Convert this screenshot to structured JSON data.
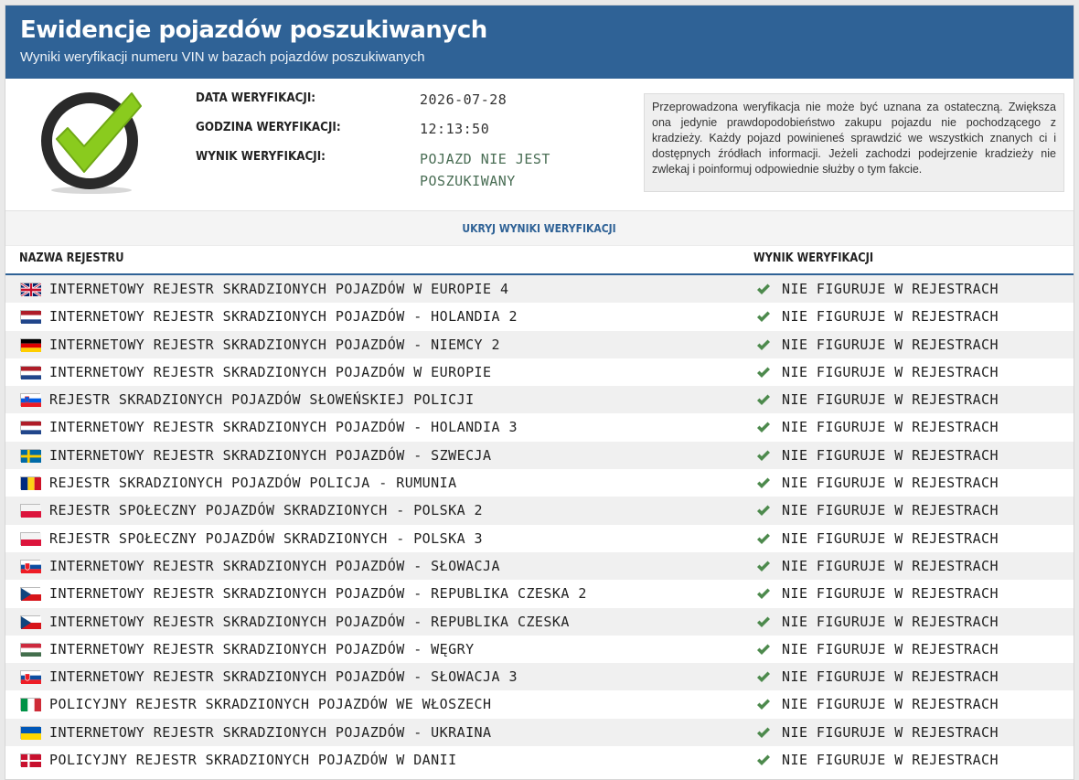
{
  "header": {
    "title": "Ewidencje pojazdów poszukiwanych",
    "subtitle": "Wyniki weryfikacji numeru VIN w bazach pojazdów poszukiwanych"
  },
  "summary": {
    "date_label": "DATA WERYFIKACJI:",
    "date_value": "2026-07-28",
    "time_label": "GODZINA WERYFIKACJI:",
    "time_value": "12:13:50",
    "result_label": "WYNIK WERYFIKACJI:",
    "result_value": "POJAZD NIE JEST POSZUKIWANY",
    "note": "Przeprowadzona weryfikacja nie może być uznana za ostateczną. Zwiększa ona jedynie prawdopodobieństwo zakupu pojazdu nie pochodzącego z kradzieży. Każdy pojazd powinieneś sprawdzić we wszystkich znanych ci i dostępnych źródłach informacji. Jeżeli zachodzi podejrzenie kradzieży nie zwlekaj i poinformuj odpowiednie służby o tym fakcie."
  },
  "toggle_label": "UKRYJ WYNIKI WERYFIKACJI",
  "table": {
    "col_name": "NAZWA REJESTRU",
    "col_result": "WYNIK WERYFIKACJI",
    "rows": [
      {
        "flag": "uk",
        "name": "INTERNETOWY REJESTR SKRADZIONYCH POJAZDÓW W EUROPIE 4",
        "result": "NIE FIGURUJE W REJESTRACH"
      },
      {
        "flag": "nl",
        "name": "INTERNETOWY REJESTR SKRADZIONYCH POJAZDÓW - HOLANDIA 2",
        "result": "NIE FIGURUJE W REJESTRACH"
      },
      {
        "flag": "de",
        "name": "INTERNETOWY REJESTR SKRADZIONYCH POJAZDÓW - NIEMCY 2",
        "result": "NIE FIGURUJE W REJESTRACH"
      },
      {
        "flag": "nl",
        "name": "INTERNETOWY REJESTR SKRADZIONYCH POJAZDÓW W EUROPIE",
        "result": "NIE FIGURUJE W REJESTRACH"
      },
      {
        "flag": "si",
        "name": "REJESTR SKRADZIONYCH POJAZDÓW SŁOWEŃSKIEJ POLICJI",
        "result": "NIE FIGURUJE W REJESTRACH"
      },
      {
        "flag": "nl",
        "name": "INTERNETOWY REJESTR SKRADZIONYCH POJAZDÓW - HOLANDIA 3",
        "result": "NIE FIGURUJE W REJESTRACH"
      },
      {
        "flag": "se",
        "name": "INTERNETOWY REJESTR SKRADZIONYCH POJAZDÓW - SZWECJA",
        "result": "NIE FIGURUJE W REJESTRACH"
      },
      {
        "flag": "ro",
        "name": "REJESTR SKRADZIONYCH POJAZDÓW POLICJA - RUMUNIA",
        "result": "NIE FIGURUJE W REJESTRACH"
      },
      {
        "flag": "pl",
        "name": "REJESTR SPOŁECZNY POJAZDÓW SKRADZIONYCH - POLSKA 2",
        "result": "NIE FIGURUJE W REJESTRACH"
      },
      {
        "flag": "pl",
        "name": "REJESTR SPOŁECZNY POJAZDÓW SKRADZIONYCH - POLSKA 3",
        "result": "NIE FIGURUJE W REJESTRACH"
      },
      {
        "flag": "sk",
        "name": "INTERNETOWY REJESTR SKRADZIONYCH POJAZDÓW - SŁOWACJA",
        "result": "NIE FIGURUJE W REJESTRACH"
      },
      {
        "flag": "cz",
        "name": "INTERNETOWY REJESTR SKRADZIONYCH POJAZDÓW - REPUBLIKA CZESKA 2",
        "result": "NIE FIGURUJE W REJESTRACH"
      },
      {
        "flag": "cz",
        "name": "INTERNETOWY REJESTR SKRADZIONYCH POJAZDÓW - REPUBLIKA CZESKA",
        "result": "NIE FIGURUJE W REJESTRACH"
      },
      {
        "flag": "hu",
        "name": "INTERNETOWY REJESTR SKRADZIONYCH POJAZDÓW - WĘGRY",
        "result": "NIE FIGURUJE W REJESTRACH"
      },
      {
        "flag": "sk",
        "name": "INTERNETOWY REJESTR SKRADZIONYCH POJAZDÓW - SŁOWACJA 3",
        "result": "NIE FIGURUJE W REJESTRACH"
      },
      {
        "flag": "it",
        "name": "POLICYJNY REJESTR SKRADZIONYCH POJAZDÓW WE WŁOSZECH",
        "result": "NIE FIGURUJE W REJESTRACH"
      },
      {
        "flag": "ua",
        "name": "INTERNETOWY REJESTR SKRADZIONYCH POJAZDÓW - UKRAINA",
        "result": "NIE FIGURUJE W REJESTRACH"
      },
      {
        "flag": "dk",
        "name": "POLICYJNY REJESTR SKRADZIONYCH POJAZDÓW W DANII",
        "result": "NIE FIGURUJE W REJESTRACH"
      }
    ]
  },
  "colors": {
    "header_bg": "#2f6296",
    "check_green": "#8acb1e",
    "ok_green": "#4d8a4d",
    "result_text": "#4a6e55"
  }
}
